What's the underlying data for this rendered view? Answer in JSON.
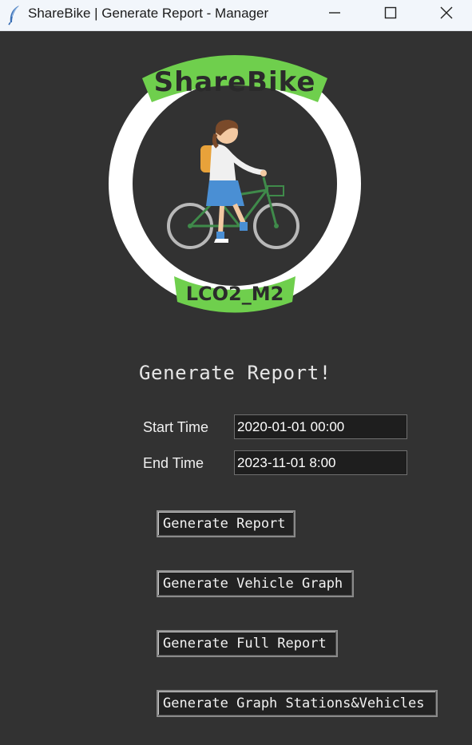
{
  "window": {
    "title": "ShareBike | Generate Report - Manager",
    "app_icon": "feather-icon",
    "controls": {
      "minimize": "minimize-icon",
      "maximize": "maximize-icon",
      "close": "close-icon"
    }
  },
  "logo": {
    "brand_text": "ShareBike",
    "badge_text": "LCO2_M2",
    "colors": {
      "ring": "#ffffff",
      "banner": "#6fcf4d",
      "banner_text": "#2b2b2b"
    }
  },
  "form": {
    "heading": "Generate Report!",
    "start_label": "Start Time",
    "start_value": "2020-01-01 00:00",
    "end_label": "End Time",
    "end_value": "2023-11-01 8:00"
  },
  "buttons": {
    "report": "Generate Report",
    "vehicle_graph": "Generate Vehicle Graph",
    "full_report": "Generate Full Report",
    "graph_stations_vehicles": "Generate Graph Stations&Vehicles"
  },
  "colors": {
    "background": "#323232",
    "titlebar": "#f2f6fb"
  }
}
